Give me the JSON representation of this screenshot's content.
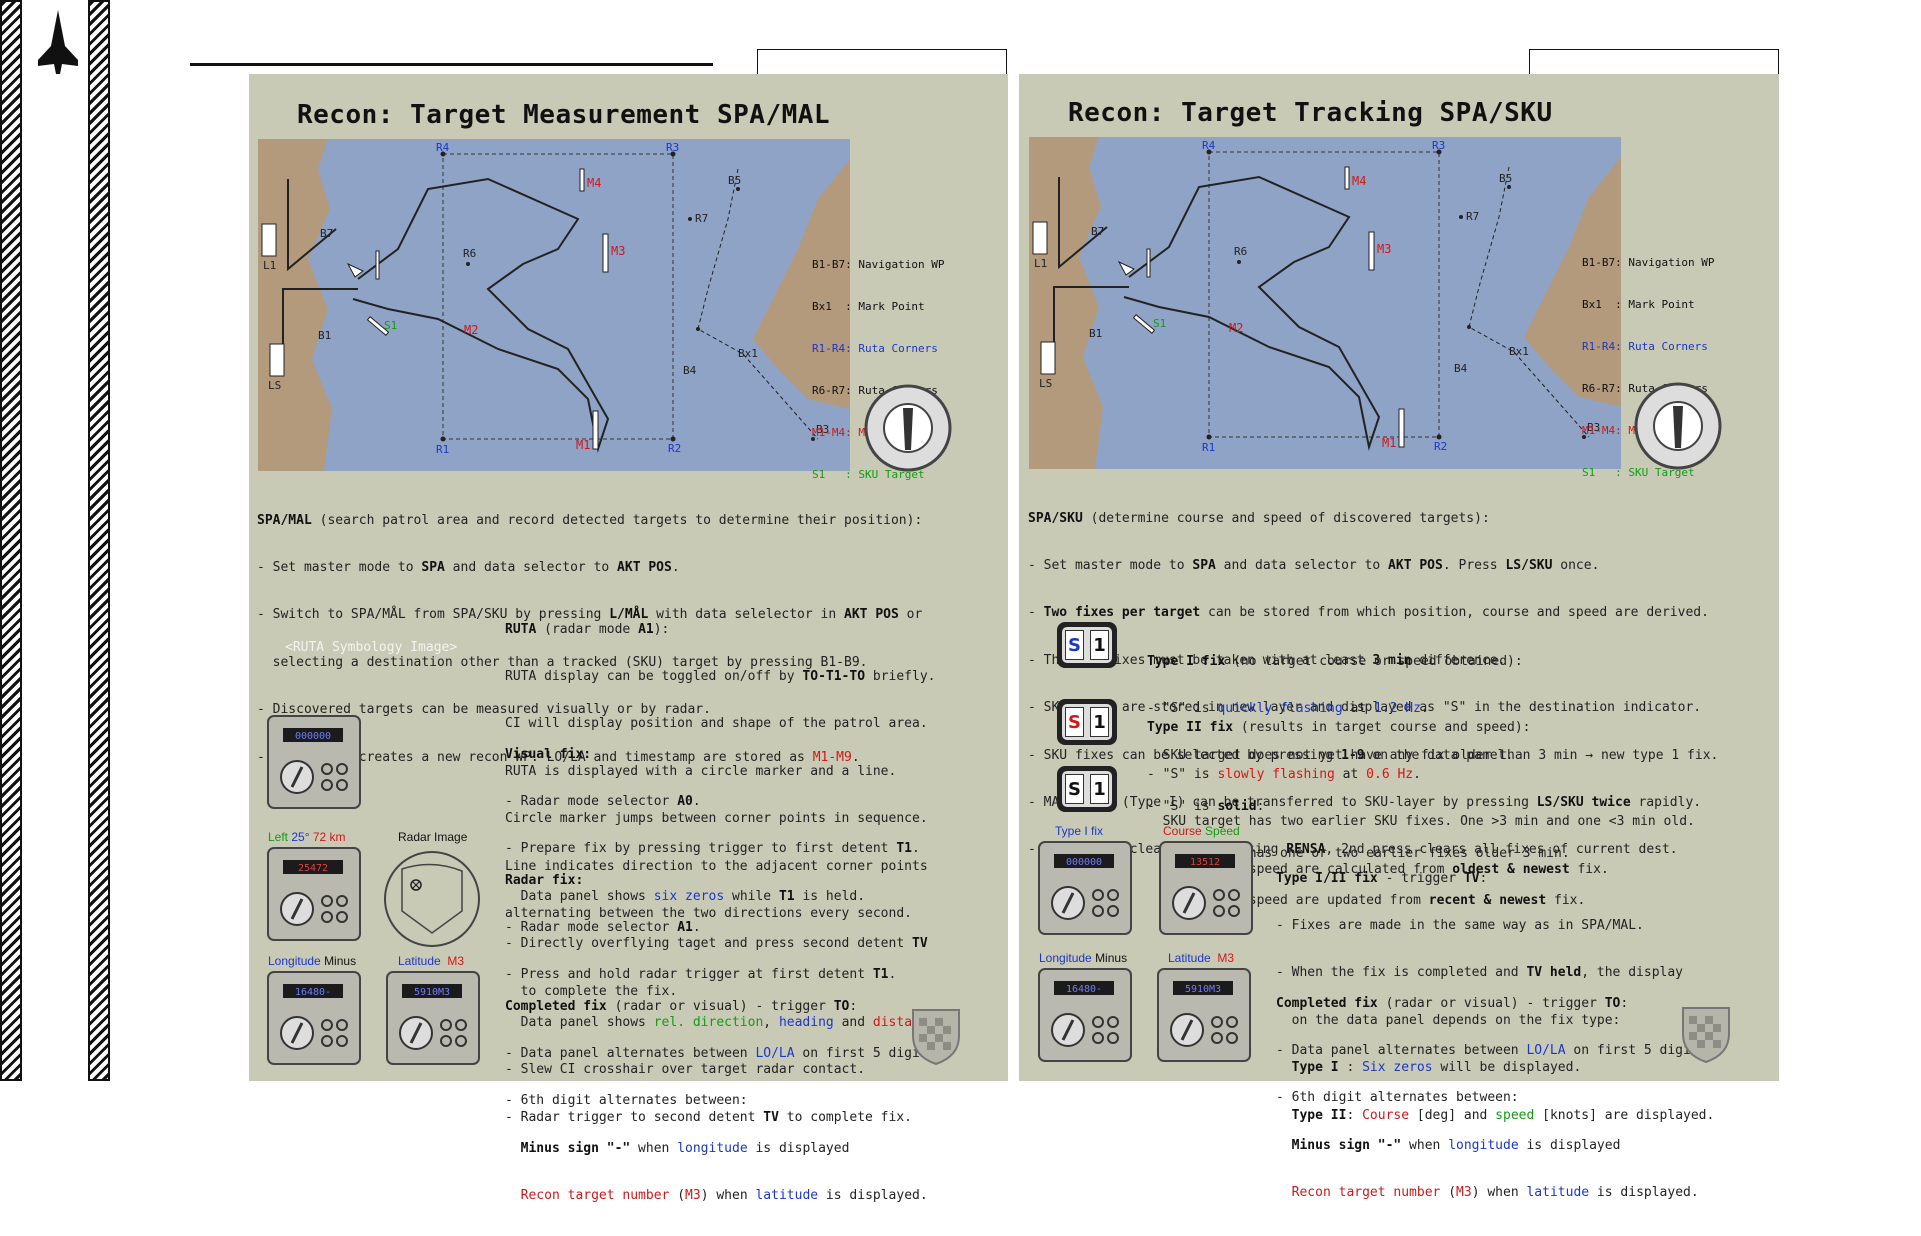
{
  "left_panel": {
    "title": "Recon: Target Measurement SPA/MAL",
    "map": {
      "labels": {
        "R1": "R1",
        "R2": "R2",
        "R3": "R3",
        "R4": "R4",
        "R6": "R6",
        "R7": "R7",
        "B1": "B1",
        "B3": "B3",
        "B4": "B4",
        "B5": "B5",
        "B7": "B7",
        "Bx1": "Bx1",
        "M1": "M1",
        "M2": "M2",
        "M3": "M3",
        "M4": "M4",
        "S1": "S1",
        "L1": "L1",
        "LS": "LS"
      },
      "legend": [
        {
          "key": "B1-B7:",
          "text": " Navigation WP",
          "color": "#111111"
        },
        {
          "key": "Bx1  :",
          "text": " Mark Point",
          "color": "#111111"
        },
        {
          "key": "R1-R4:",
          "text": " Ruta Corners",
          "color": "#1d36c8"
        },
        {
          "key": "R6-R7:",
          "text": " Ruta Centers",
          "color": "#111111"
        },
        {
          "key": "M1-M4:",
          "text": " MÅL Targets",
          "color": "#d01818"
        },
        {
          "key": "S1   :",
          "text": " SKU Target",
          "color": "#149a14"
        }
      ]
    },
    "intro": {
      "head_bold": "SPA/MAL",
      "head_rest": " (search patrol area and record detected targets to determine their position):",
      "l1a": "- Set master mode to ",
      "l1b": "SPA",
      "l1c": " and data selector to ",
      "l1d": "AKT POS",
      "l1e": ".",
      "l2a": "- Switch to SPA/MÅL from SPA/SKU by pressing ",
      "l2b": "L/MÅL",
      "l2c": " with data selelector in ",
      "l2d": "AKT POS",
      "l2e": " or",
      "l3": "  selecting a destination other than a tracked (SKU) target by pressing B1-B9.",
      "l4": "- Discovered targets can be measured visually or by radar.",
      "l5a": "- Target fix creates a new recon WP. LO/LA and timestamp are stored as ",
      "l5b": "M1-M9",
      "l5c": "."
    },
    "ruta_image_placeholder": "<RUTA Symbology Image>",
    "ruta": {
      "head_bold": "RUTA",
      "head_rest": " (radar mode ",
      "head_mode": "A1",
      "head_end": "):",
      "l1a": "RUTA display can be toggled on/off by ",
      "l1b": "TO-T1-TO",
      "l1c": " briefly.",
      "l2": "CI will display position and shape of the patrol area.",
      "l3": "RUTA is displayed with a circle marker and a line.",
      "l4": "Circle marker jumps between corner points in sequence.",
      "l5": "Line indicates direction to the adjacent corner points",
      "l6": "alternating between the two directions every second."
    },
    "visual": {
      "head": "Visual fix:",
      "l1a": "- Radar mode selector ",
      "l1b": "A0",
      "l1c": ".",
      "l2a": "- Prepare fix by pressing trigger to first detent ",
      "l2b": "T1",
      "l2c": ".",
      "l3a": "  Data panel shows ",
      "l3b": "six zeros",
      "l3c": " while ",
      "l3d": "T1",
      "l3e": " is held.",
      "l4a": "- Directly overflying taget and press second detent ",
      "l4b": "TV",
      "l5": "  to complete the fix."
    },
    "radar": {
      "head": "Radar fix:",
      "l1a": "- Radar mode selector ",
      "l1b": "A1",
      "l1c": ".",
      "l2a": "- Press and hold radar trigger at first detent ",
      "l2b": "T1",
      "l2c": ".",
      "l3a": "  Data panel shows ",
      "l3b": "rel. direction",
      "l3c": ", ",
      "l3d": "heading",
      "l3e": " and ",
      "l3f": "distance",
      "l3g": ".",
      "l4": "- Slew CI crosshair over target radar contact.",
      "l5a": "- Radar trigger to second detent ",
      "l5b": "TV",
      "l5c": " to complete fix."
    },
    "completed": {
      "head_bold": "Completed fix",
      "head_rest": " (radar or visual) - trigger ",
      "head_to": "TO",
      "head_end": ":",
      "l1a": "- Data panel alternates between ",
      "l1b": "LO/LA",
      "l1c": " on first 5 digits.",
      "l2": "- 6th digit alternates between:",
      "l3a": "  Minus sign \"-\"",
      "l3b": " when ",
      "l3c": "longitude",
      "l3d": " is displayed",
      "l4a": "  Recon target number",
      "l4b": " (",
      "l4c": "M3",
      "l4d": ") when ",
      "l4e": "latitude",
      "l4f": " is displayed."
    },
    "captions": {
      "left": "Left",
      "deg": "25°",
      "km": "72 km",
      "radar_image": "Radar Image",
      "longitude": "Longitude",
      "minus": "Minus",
      "latitude": "Latitude",
      "m3": "M3"
    },
    "device_readouts": {
      "zeros": "000000",
      "radar": "25472",
      "lon": "16480-",
      "lat": "5910M3"
    }
  },
  "right_panel": {
    "title": "Recon: Target Tracking SPA/SKU",
    "intro": {
      "head_bold": "SPA/SKU",
      "head_rest": " (determine course and speed of discovered targets):",
      "l1a": "- Set master mode to ",
      "l1b": "SPA",
      "l1c": " and data selector to ",
      "l1d": "AKT POS",
      "l1e": ". Press ",
      "l1f": "LS/SKU",
      "l1g": " once.",
      "l2a": "- ",
      "l2b": "Two fixes per target",
      "l2c": " can be stored from which position, course and speed are derived.",
      "l3a": "- The two fixes must be taken with at least ",
      "l3b": "3 min",
      "l3c": " difference.",
      "l4": "- SKU fixes are stored in new layer and displayed as \"S\" in the destination indicator.",
      "l5a": "- SKU fixes can be selected by pressing ",
      "l5b": "1-9",
      "l5c": " on the data panel.",
      "l6a": "- MAL fixes (Type I) can be transferred to SKU-layer by pressing ",
      "l6b": "LS/SKU twice",
      "l6c": " rapidly.",
      "l7a": "- Latest fix cleared by pressing ",
      "l7b": "RENSA",
      "l7c": ", 2nd press clears all fixes of current dest."
    },
    "type1": {
      "head_bold": "Type I fix",
      "head_rest": " (no target course or speed obtained):",
      "l1a": "- \"S\" is ",
      "l1b": "quickly flashing",
      "l1c": " at ",
      "l1d": "1.2 Hz",
      "l1e": ".",
      "l2": "  SKU target does not yet have any fix older than 3 min → new type 1 fix."
    },
    "type2": {
      "head_bold": "Type II fix",
      "head_rest": " (results in target course and speed):",
      "l1a": "- \"S\" is ",
      "l1b": "slowly flashing",
      "l1c": " at ",
      "l1d": "0.6 Hz",
      "l1e": ".",
      "l2": "  SKU target has two earlier SKU fixes. One >3 min and one <3 min old.",
      "l3a": "  Course and speed are calculated from ",
      "l3b": "oldest & newest",
      "l3c": " fix."
    },
    "solid": {
      "l1a": "- \"S\" is ",
      "l1b": "solid",
      "l1c": ":",
      "l2": "  SKU target has one or two earlier fixes older 3 min.",
      "l3a": "  Course and speed are updated from ",
      "l3b": "recent & newest",
      "l3c": " fix."
    },
    "indicator": {
      "s": "S",
      "one": "1"
    },
    "type12": {
      "head_bold": "Type I/II fix",
      "head_rest": " - trigger ",
      "head_tv": "TV",
      "head_end": ":",
      "l1": "- Fixes are made in the same way as in SPA/MAL.",
      "l2a": "- When the fix is completed and ",
      "l2b": "TV held",
      "l2c": ", the display",
      "l3": "  on the data panel depends on the fix type:",
      "l4a": "  ",
      "l4b": "Type I",
      "l4c": " : ",
      "l4d": "Six zeros",
      "l4e": " will be displayed.",
      "l5a": "  ",
      "l5b": "Type II",
      "l5c": ": ",
      "l5d": "Course",
      "l5e": " [deg] and ",
      "l5f": "speed",
      "l5g": " [knots] are displayed."
    },
    "completed": {
      "head_bold": "Completed fix",
      "head_rest": " (radar or visual) - trigger ",
      "head_to": "TO",
      "head_end": ":",
      "l1a": "- Data panel alternates between ",
      "l1b": "LO/LA",
      "l1c": " on first 5 digits.",
      "l2": "- 6th digit alternates between:",
      "l3a": "  Minus sign \"-\"",
      "l3b": " when ",
      "l3c": "longitude",
      "l3d": " is displayed",
      "l4a": "  Recon target number",
      "l4b": " (",
      "l4c": "M3",
      "l4d": ") when ",
      "l4e": "latitude",
      "l4f": " is displayed."
    },
    "captions": {
      "type1": "Type I fix",
      "course": "Course",
      "speed": "Speed",
      "longitude": "Longitude",
      "minus": "Minus",
      "latitude": "Latitude",
      "m3": "M3"
    },
    "device_readouts": {
      "zeros": "000000",
      "course": "13512",
      "lon": "16480-",
      "lat": "5910M3"
    }
  },
  "colors": {
    "panel": "#c9cab6",
    "sea": "#8fa3c6",
    "land": "#b49a7c",
    "blue": "#1d36c8",
    "red": "#d01818",
    "green": "#149a14"
  }
}
